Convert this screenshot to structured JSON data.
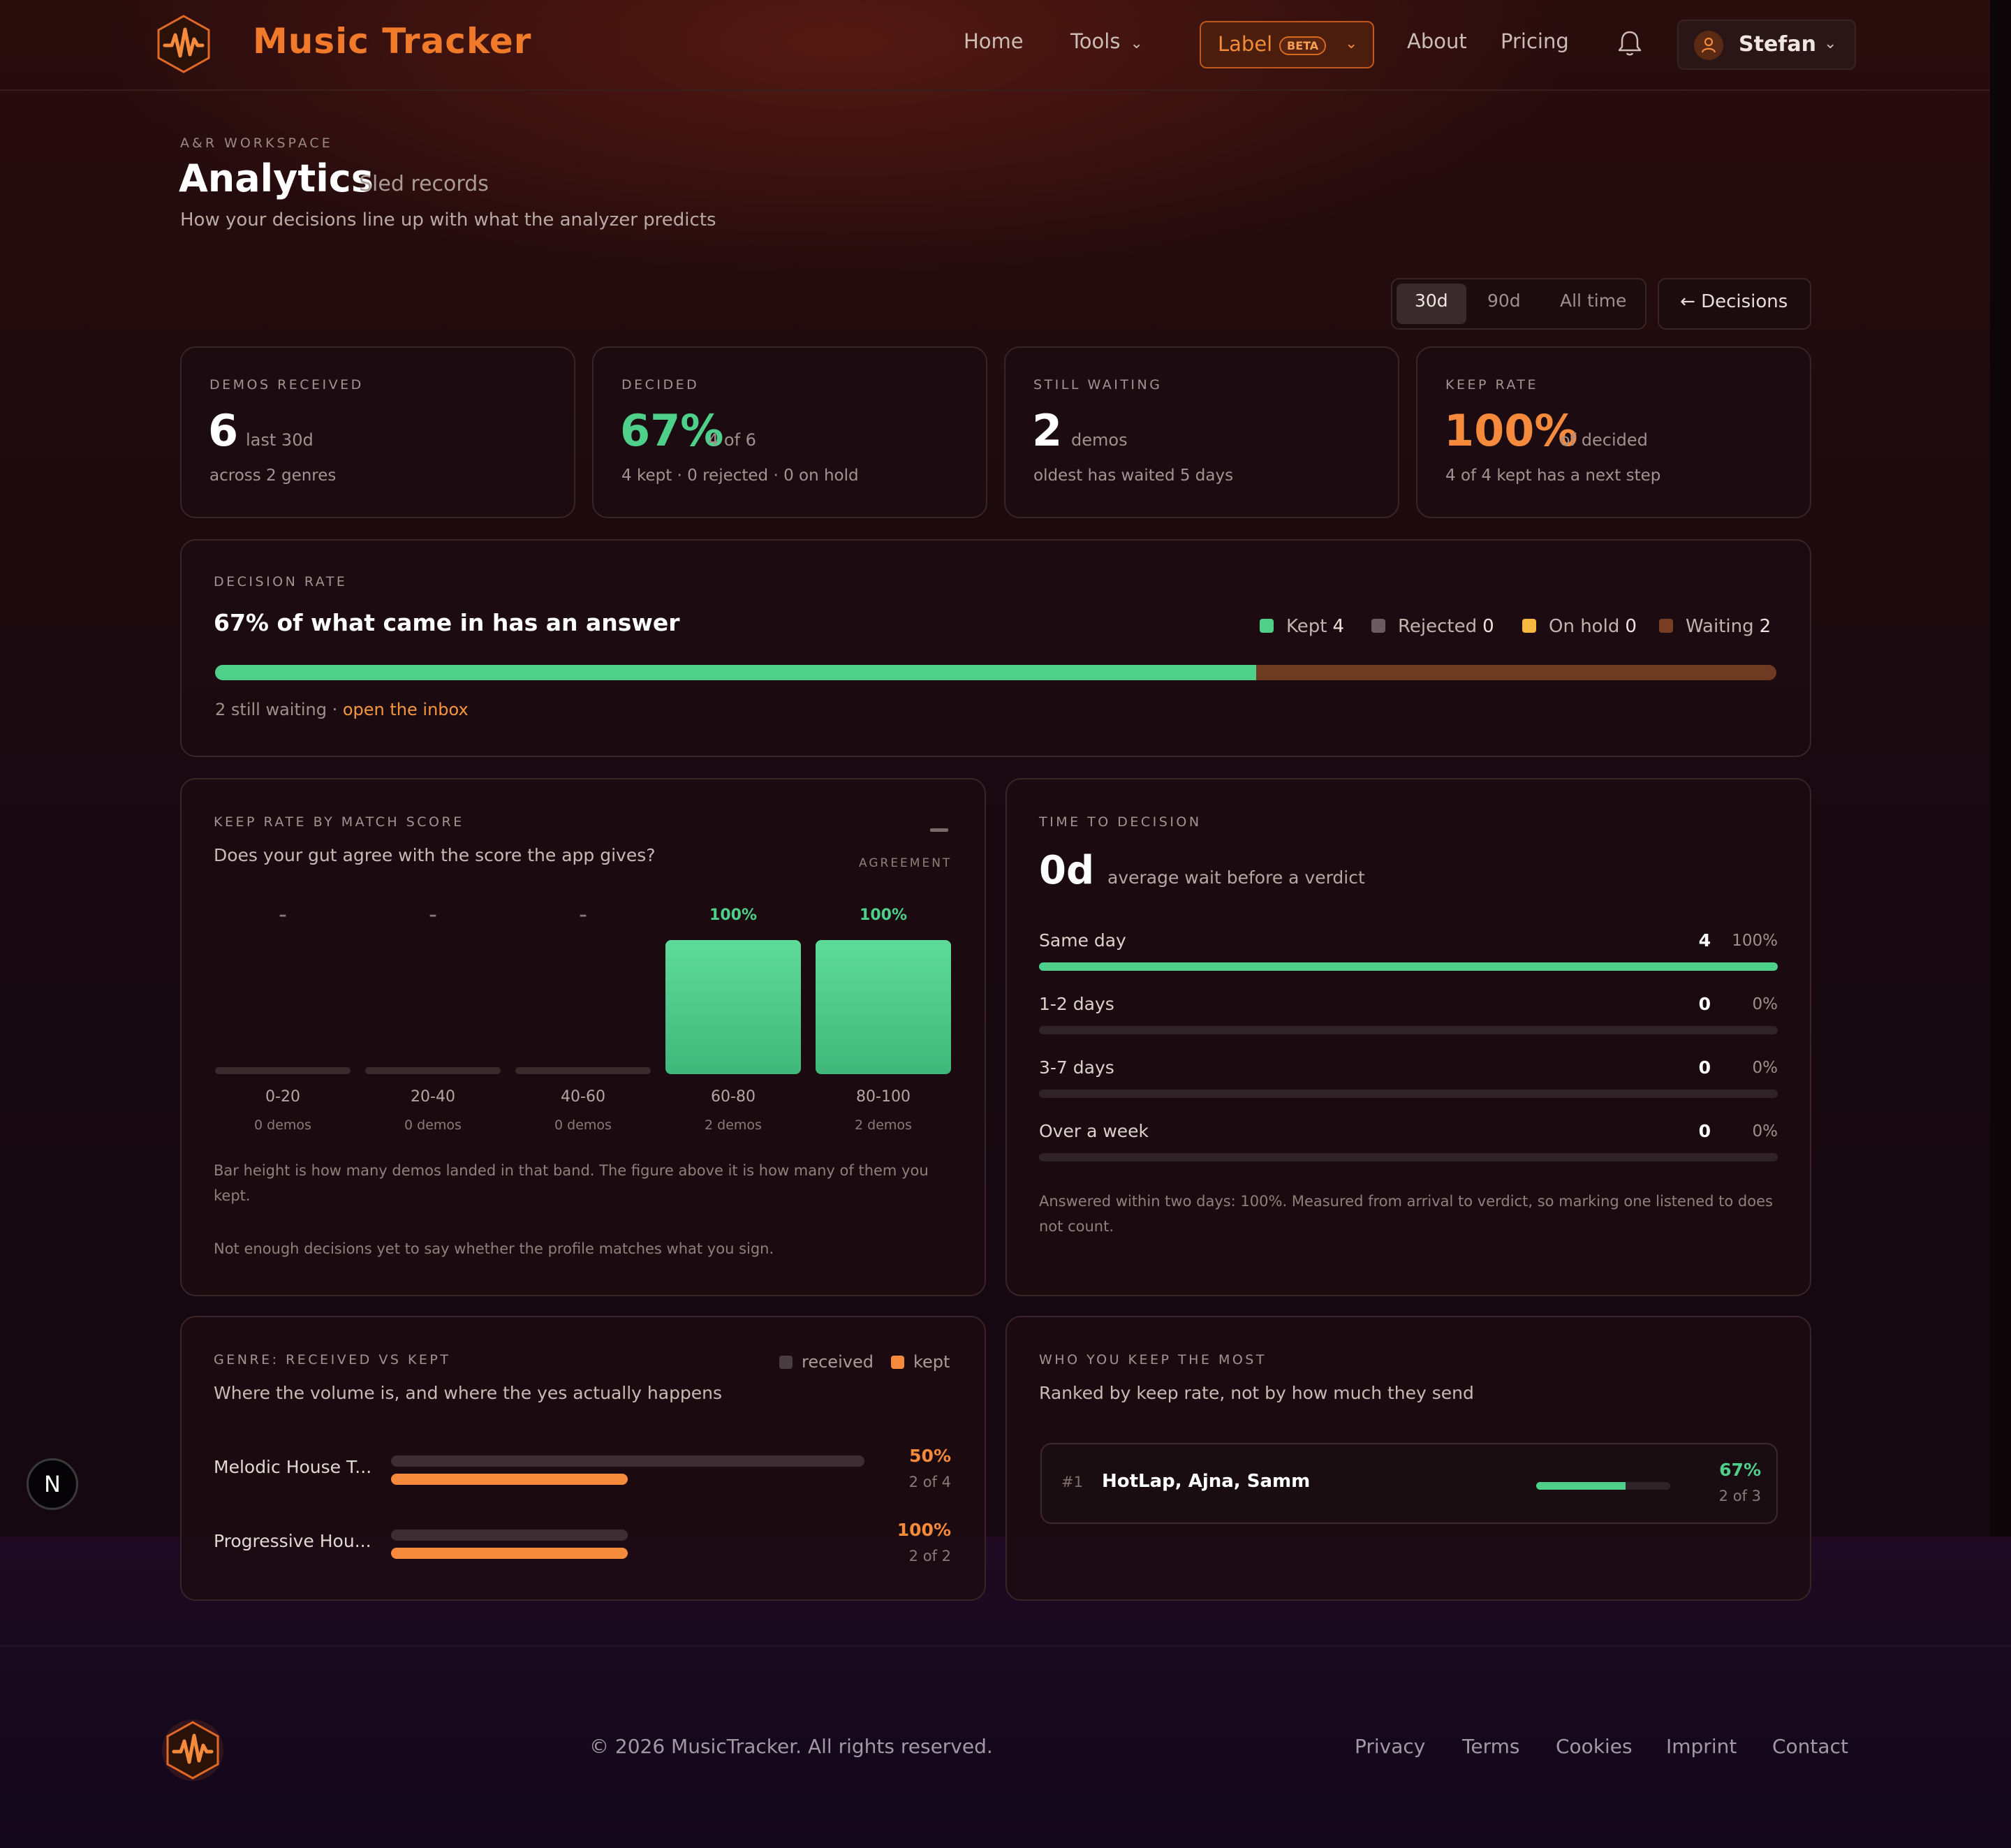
{
  "brand": "Music Tracker",
  "nav": {
    "home": "Home",
    "tools": "Tools",
    "label": "Label",
    "beta": "BETA",
    "about": "About",
    "pricing": "Pricing",
    "user": "Stefan"
  },
  "page": {
    "kicker": "A&R WORKSPACE",
    "title": "Analytics",
    "title_sub": "Sled records",
    "subtitle": "How your decisions line up with what the analyzer predicts"
  },
  "range": {
    "options": [
      "30d",
      "90d",
      "All time"
    ],
    "selected": "30d",
    "decisions_button": "Decisions"
  },
  "stats": [
    {
      "label": "DEMOS RECEIVED",
      "value": "6",
      "unit": "last 30d",
      "foot": "across 2 genres",
      "color": "#ffffff"
    },
    {
      "label": "DECIDED",
      "value": "67%",
      "unit": "4 of 6",
      "foot": "4 kept · 0 rejected · 0 on hold",
      "color": "#4fd08a"
    },
    {
      "label": "STILL WAITING",
      "value": "2",
      "unit": "demos",
      "foot": "oldest has waited 5 days",
      "color": "#ffffff"
    },
    {
      "label": "KEEP RATE",
      "value": "100%",
      "unit": "of decided",
      "foot": "4 of 4 kept has a next step",
      "color": "#f58a3d"
    }
  ],
  "decision_rate": {
    "label": "DECISION RATE",
    "title": "67% of what came in has an answer",
    "legend": [
      {
        "name": "Kept",
        "value": "4",
        "color": "#4fd08a"
      },
      {
        "name": "Rejected",
        "value": "0",
        "color": "#6b5c61"
      },
      {
        "name": "On hold",
        "value": "0",
        "color": "#f5b841"
      },
      {
        "name": "Waiting",
        "value": "2",
        "color": "#7a3e22"
      }
    ],
    "kept_fraction": 0.667,
    "note": "2 still waiting · ",
    "link": "open the inbox"
  },
  "keep_rate_by_score": {
    "label": "KEEP RATE BY MATCH SCORE",
    "description": "Does your gut agree with the score the app gives?",
    "agreement_label": "AGREEMENT",
    "note1": "Bar height is how many demos landed in that band. The figure above it is how many of them you kept.",
    "note2": "Not enough decisions yet to say whether the profile matches what you sign."
  },
  "chart_data": {
    "type": "bar",
    "title": "KEEP RATE BY MATCH SCORE",
    "categories": [
      "0-20",
      "20-40",
      "40-60",
      "60-80",
      "80-100"
    ],
    "values": [
      0,
      0,
      0,
      2,
      2
    ],
    "count_labels": [
      "0 demos",
      "0 demos",
      "0 demos",
      "2 demos",
      "2 demos"
    ],
    "keep_labels": [
      "–",
      "–",
      "–",
      "100%",
      "100%"
    ],
    "ylim": [
      0,
      2
    ],
    "bar_color": "#4fd08a"
  },
  "time_to_decision": {
    "label": "TIME TO DECISION",
    "value": "0d",
    "unit": "average wait before a verdict",
    "rows": [
      {
        "label": "Same day",
        "count": "4",
        "pct": "100%",
        "fraction": 1.0
      },
      {
        "label": "1-2 days",
        "count": "0",
        "pct": "0%",
        "fraction": 0
      },
      {
        "label": "3-7 days",
        "count": "0",
        "pct": "0%",
        "fraction": 0
      },
      {
        "label": "Over a week",
        "count": "0",
        "pct": "0%",
        "fraction": 0
      }
    ],
    "note": "Answered within two days: 100%. Measured from arrival to verdict, so marking one listened to does not count."
  },
  "genre": {
    "label": "GENRE: RECEIVED VS KEPT",
    "description": "Where the volume is, and where the yes actually happens",
    "legend_received": "received",
    "legend_kept": "kept",
    "rows": [
      {
        "name": "Melodic House T...",
        "received": 4,
        "kept": 2,
        "pct": "50%",
        "frac": "2 of 4"
      },
      {
        "name": "Progressive Hou...",
        "received": 2,
        "kept": 2,
        "pct": "100%",
        "frac": "2 of 2"
      }
    ]
  },
  "who_you_keep": {
    "label": "WHO YOU KEEP THE MOST",
    "description": "Ranked by keep rate, not by how much they send",
    "rows": [
      {
        "rank": "#1",
        "name": "HotLap, Ajna, Samm",
        "pct": "67%",
        "frac": "2 of 3",
        "fraction": 0.667
      }
    ]
  },
  "floating_badge": "N",
  "footer": {
    "copyright": "© 2026 MusicTracker. All rights reserved.",
    "links": [
      "Privacy",
      "Terms",
      "Cookies",
      "Imprint",
      "Contact"
    ]
  }
}
